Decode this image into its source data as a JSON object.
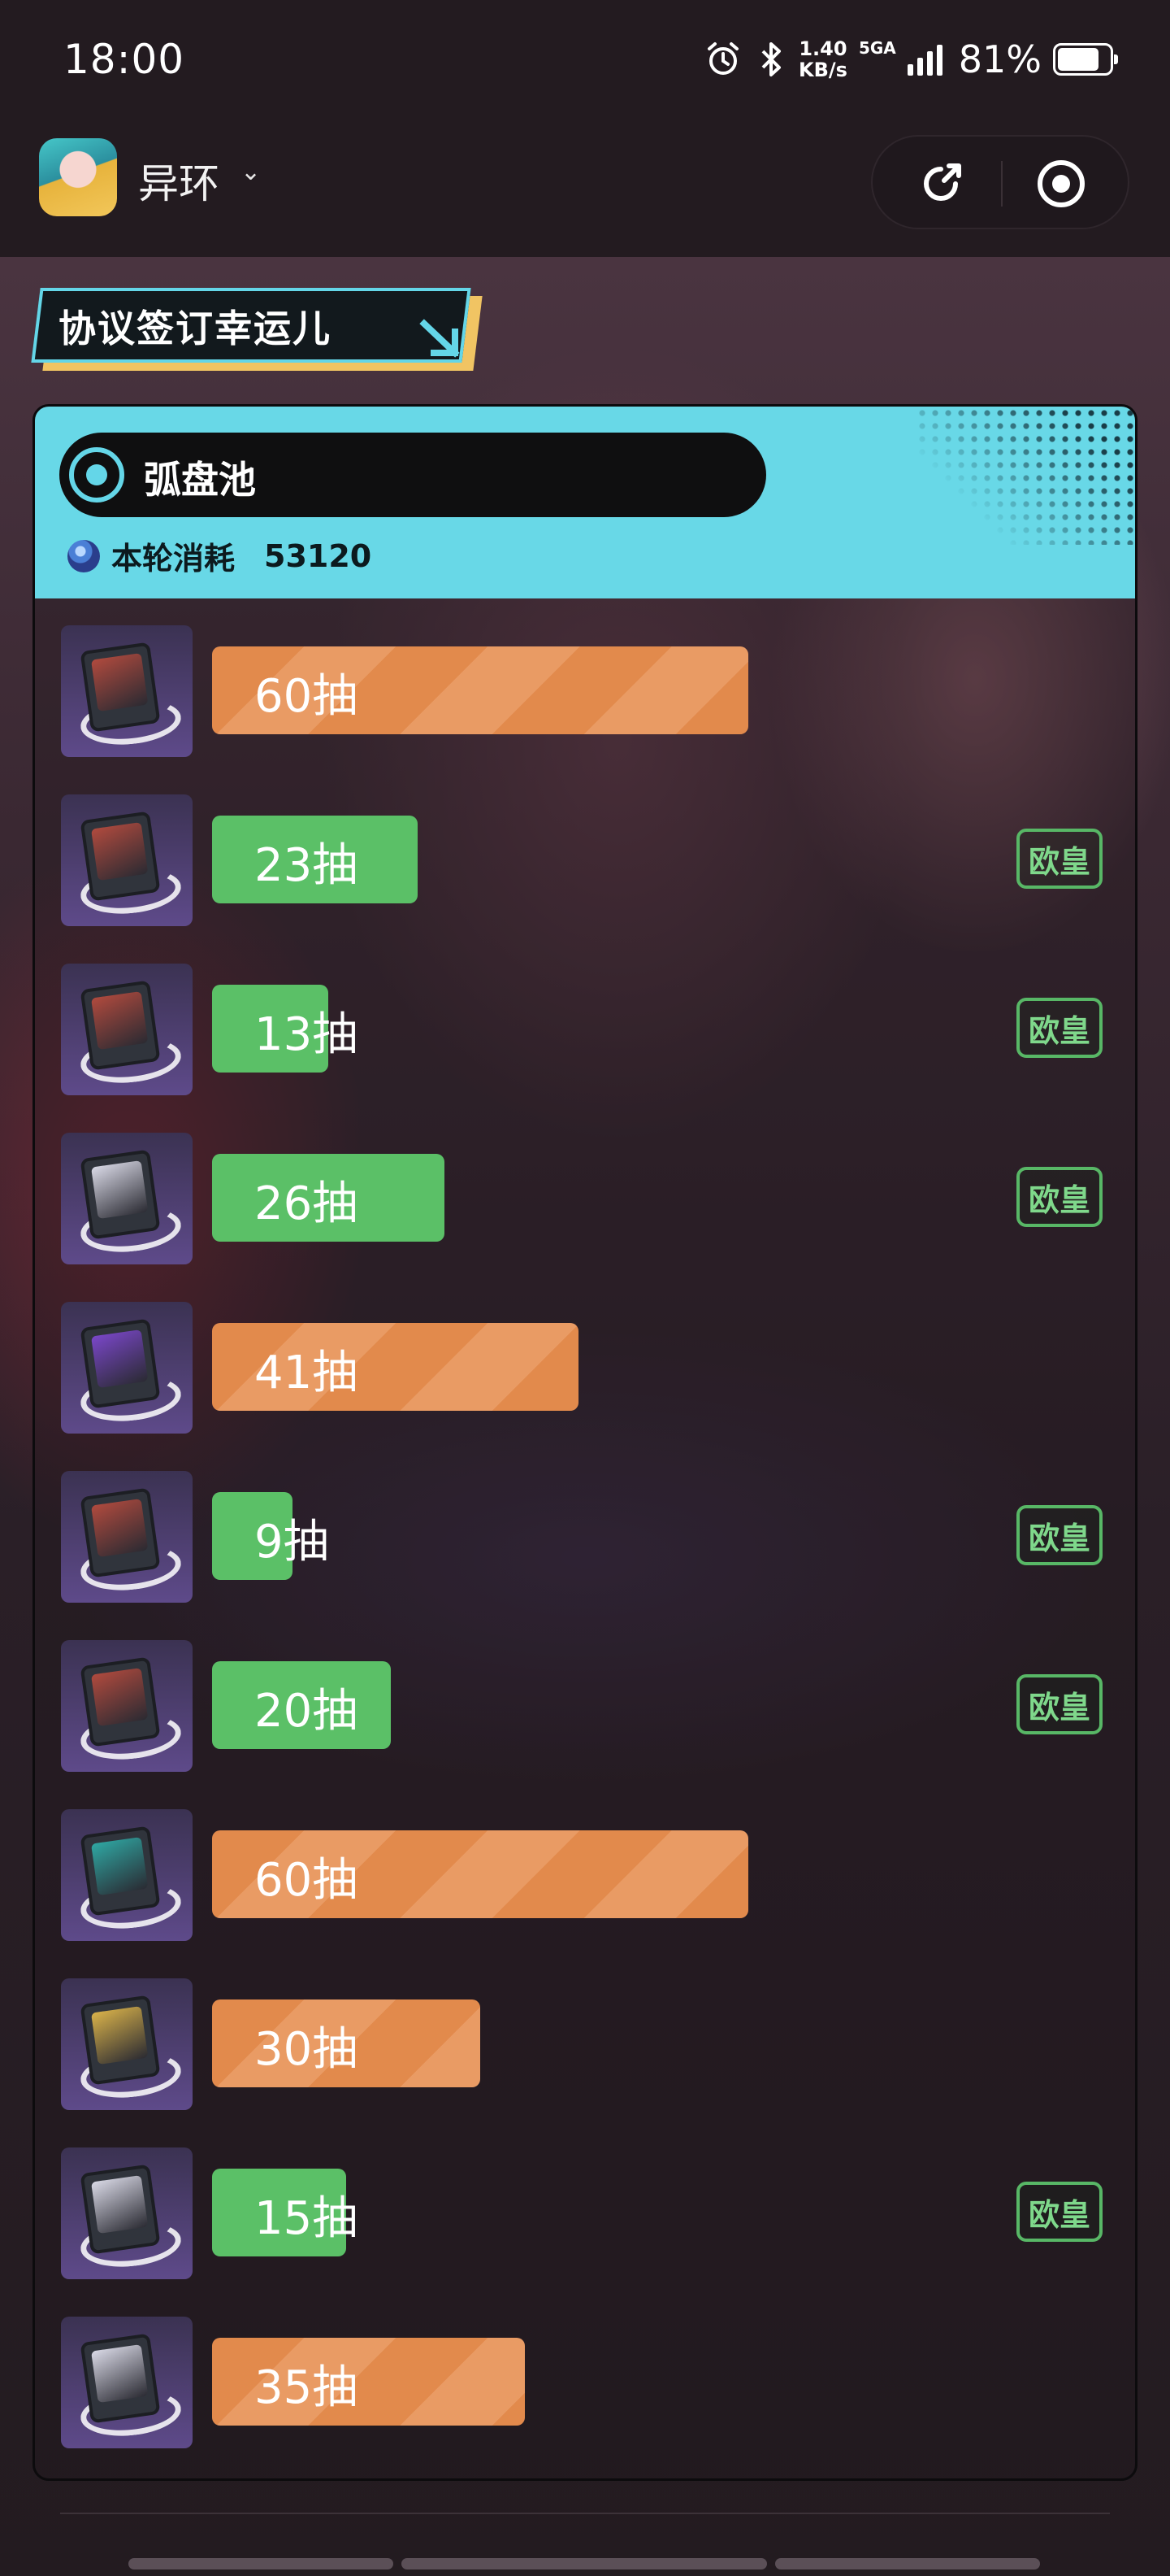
{
  "status_bar": {
    "time": "18:00",
    "net_speed_value": "1.40",
    "net_speed_unit": "KB/s",
    "signal_label": "5GA",
    "battery_percent": "81%",
    "battery_level": 0.81
  },
  "app_bar": {
    "title": "异环",
    "icons": [
      "app-icon",
      "chevron-down-icon",
      "share-icon",
      "close-target-icon"
    ]
  },
  "banner": {
    "title": "协议签订幸运儿"
  },
  "pool": {
    "name": "弧盘池",
    "cost_label": "本轮消耗",
    "cost_value": "53120"
  },
  "pulls": [
    {
      "label": "60抽",
      "value": 60,
      "color": "orange",
      "badge": "",
      "art": "#b04a3e"
    },
    {
      "label": "23抽",
      "value": 23,
      "color": "green",
      "badge": "欧皇",
      "art": "#b04a3e"
    },
    {
      "label": "13抽",
      "value": 13,
      "color": "green",
      "badge": "欧皇",
      "art": "#b04a3e"
    },
    {
      "label": "26抽",
      "value": 26,
      "color": "green",
      "badge": "欧皇",
      "art": "#d9d9e6"
    },
    {
      "label": "41抽",
      "value": 41,
      "color": "orange",
      "badge": "",
      "art": "#7a47c9"
    },
    {
      "label": "9抽",
      "value": 9,
      "color": "green",
      "badge": "欧皇",
      "art": "#b04a3e"
    },
    {
      "label": "20抽",
      "value": 20,
      "color": "green",
      "badge": "欧皇",
      "art": "#b04a3e"
    },
    {
      "label": "60抽",
      "value": 60,
      "color": "orange",
      "badge": "",
      "art": "#2fa7a3"
    },
    {
      "label": "30抽",
      "value": 30,
      "color": "orange",
      "badge": "",
      "art": "#d9b24a"
    },
    {
      "label": "15抽",
      "value": 15,
      "color": "green",
      "badge": "欧皇",
      "art": "#d9d9e6"
    },
    {
      "label": "35抽",
      "value": 35,
      "color": "orange",
      "badge": "",
      "art": "#d9d9e6"
    }
  ],
  "colors": {
    "orange": "#e28a4c",
    "green": "#5bc067",
    "accent_cyan": "#68d8e7",
    "banner_gold": "#f1c463"
  }
}
